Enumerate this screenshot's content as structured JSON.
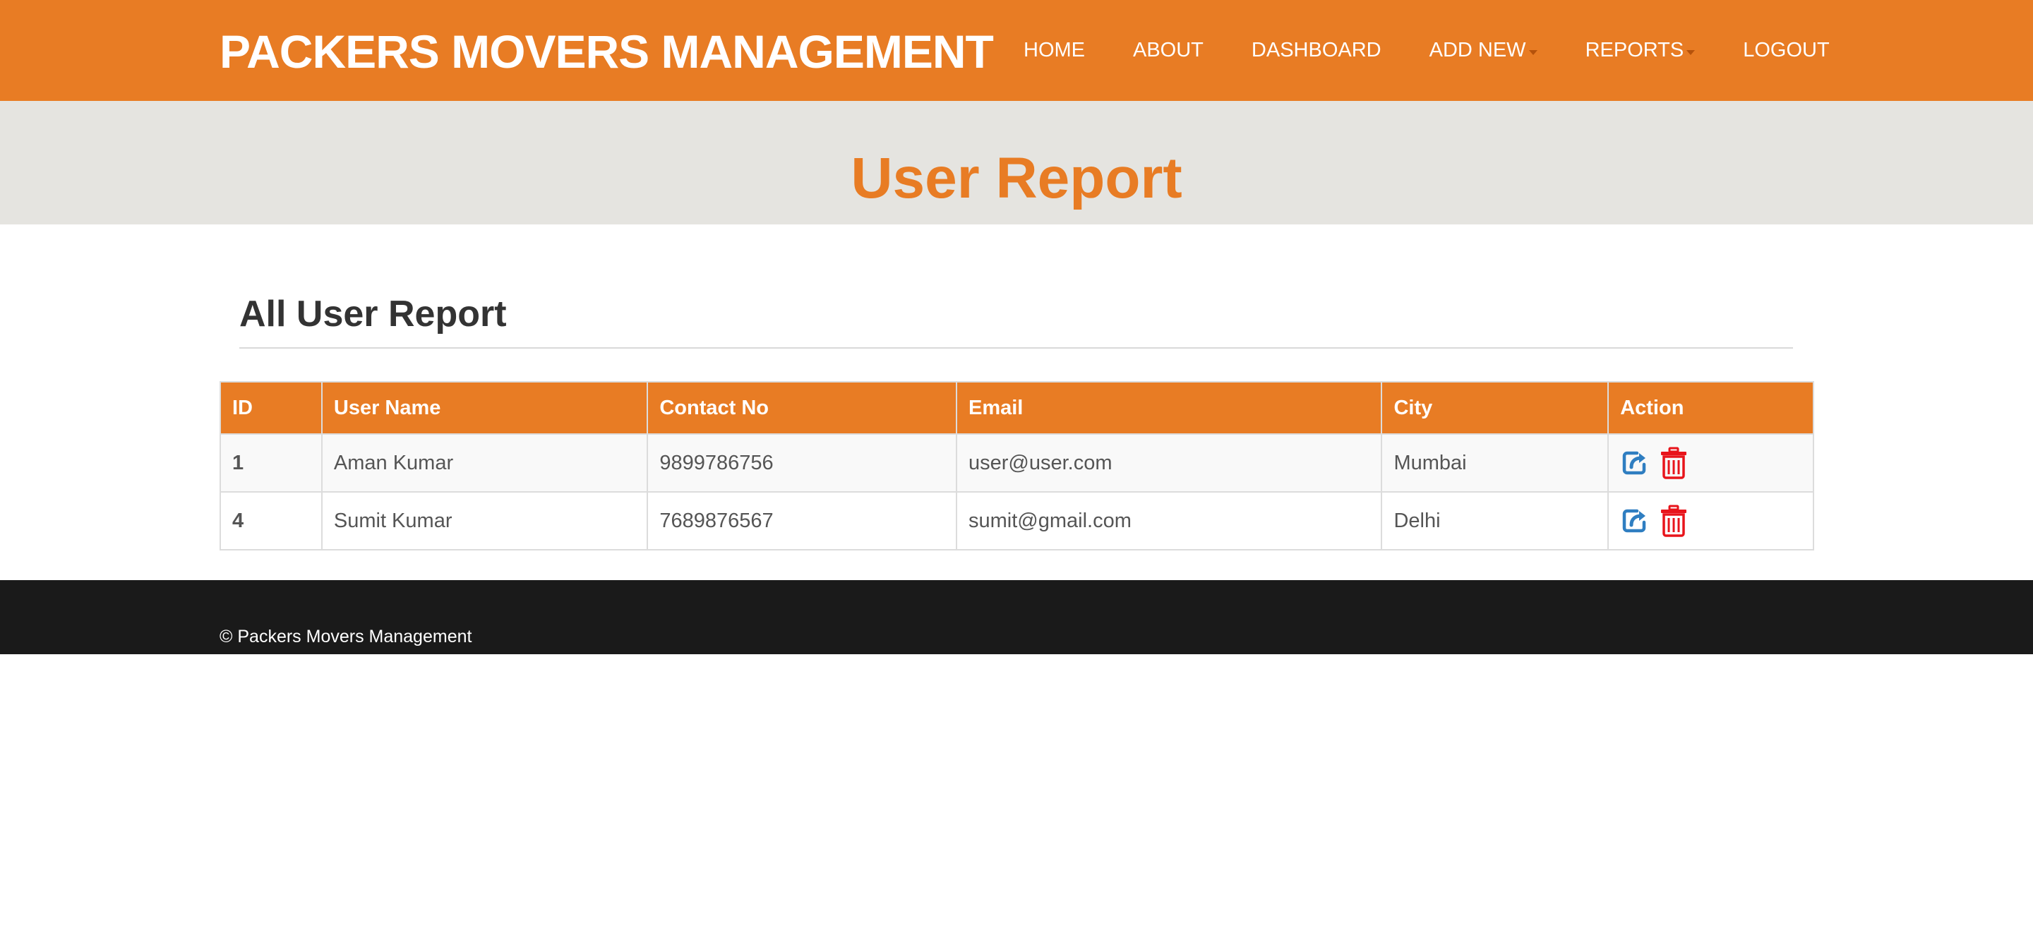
{
  "header": {
    "brand": "PACKERS MOVERS MANAGEMENT",
    "nav": [
      {
        "label": "HOME",
        "dropdown": false
      },
      {
        "label": "ABOUT",
        "dropdown": false
      },
      {
        "label": "DASHBOARD",
        "dropdown": false
      },
      {
        "label": "ADD NEW",
        "dropdown": true
      },
      {
        "label": "REPORTS",
        "dropdown": true
      },
      {
        "label": "LOGOUT",
        "dropdown": false
      }
    ]
  },
  "banner": {
    "title": "User Report"
  },
  "section": {
    "title": "All User Report"
  },
  "table": {
    "columns": [
      "ID",
      "User Name",
      "Contact No",
      "Email",
      "City",
      "Action"
    ],
    "rows": [
      {
        "id": "1",
        "user_name": "Aman Kumar",
        "contact": "9899786756",
        "email": "user@user.com",
        "city": "Mumbai"
      },
      {
        "id": "4",
        "user_name": "Sumit Kumar",
        "contact": "7689876567",
        "email": "sumit@gmail.com",
        "city": "Delhi"
      }
    ],
    "actions": [
      "edit-icon",
      "delete-icon"
    ]
  },
  "footer": {
    "text": "© Packers Movers Management"
  },
  "colors": {
    "accent": "#e87c24",
    "banner_bg": "#e5e4e0",
    "footer_bg": "#1a1a1a",
    "edit_icon": "#2f7ec1",
    "delete_icon": "#e8141b"
  }
}
